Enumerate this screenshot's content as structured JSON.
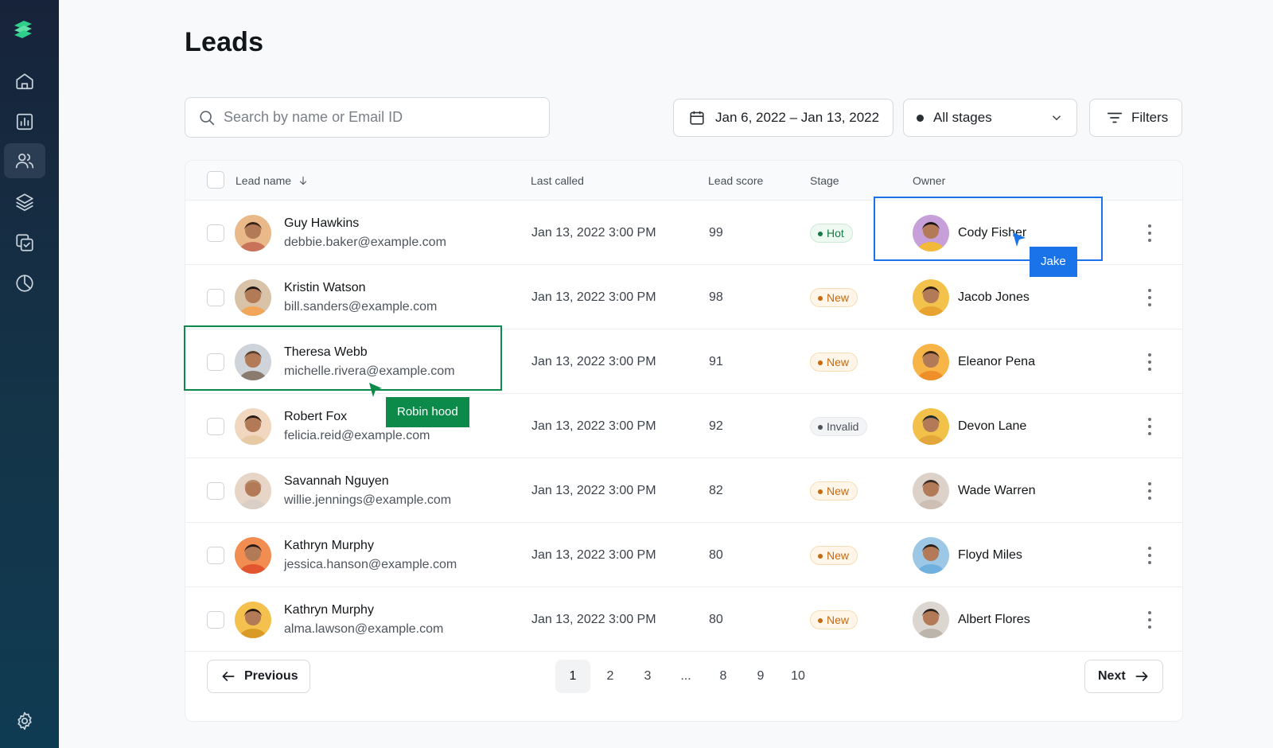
{
  "app": {
    "page_title": "Leads",
    "accent": "#0b8a4a",
    "brand_color": "#2fd08c"
  },
  "sidebar": {
    "items": [
      {
        "icon": "home-icon",
        "active": false
      },
      {
        "icon": "chart-bar-icon",
        "active": false
      },
      {
        "icon": "users-icon",
        "active": true
      },
      {
        "icon": "layers-icon",
        "active": false
      },
      {
        "icon": "copy-check-icon",
        "active": false
      },
      {
        "icon": "pie-chart-icon",
        "active": false
      }
    ],
    "settings_icon": "gear-icon"
  },
  "toolbar": {
    "search_placeholder": "Search by name or Email ID",
    "date_range": "Jan 6, 2022 – Jan 13, 2022",
    "stage_filter": "All stages",
    "filters_label": "Filters"
  },
  "table": {
    "headers": {
      "lead_name": "Lead name",
      "last_called": "Last called",
      "lead_score": "Lead score",
      "stage": "Stage",
      "owner": "Owner"
    },
    "rows": [
      {
        "name": "Guy Hawkins",
        "email": "debbie.baker@example.com",
        "last_called": "Jan 13, 2022 3:00 PM",
        "score": "99",
        "stage": "Hot",
        "owner": "Cody Fisher"
      },
      {
        "name": "Kristin Watson",
        "email": "bill.sanders@example.com",
        "last_called": "Jan 13, 2022 3:00 PM",
        "score": "98",
        "stage": "New",
        "owner": "Jacob Jones"
      },
      {
        "name": "Theresa Webb",
        "email": "michelle.rivera@example.com",
        "last_called": "Jan 13, 2022 3:00 PM",
        "score": "91",
        "stage": "New",
        "owner": "Eleanor Pena"
      },
      {
        "name": "Robert Fox",
        "email": "felicia.reid@example.com",
        "last_called": "Jan 13, 2022 3:00 PM",
        "score": "92",
        "stage": "Invalid",
        "owner": "Devon Lane"
      },
      {
        "name": "Savannah Nguyen",
        "email": "willie.jennings@example.com",
        "last_called": "Jan 13, 2022 3:00 PM",
        "score": "82",
        "stage": "New",
        "owner": "Wade Warren"
      },
      {
        "name": "Kathryn Murphy",
        "email": "jessica.hanson@example.com",
        "last_called": "Jan 13, 2022 3:00 PM",
        "score": "80",
        "stage": "New",
        "owner": "Floyd Miles"
      },
      {
        "name": "Kathryn Murphy",
        "email": "alma.lawson@example.com",
        "last_called": "Jan 13, 2022 3:00 PM",
        "score": "80",
        "stage": "New",
        "owner": "Albert Flores"
      }
    ]
  },
  "collaborators": {
    "jake": {
      "label": "Jake",
      "color": "#1a73e8"
    },
    "robin": {
      "label": "Robin hood",
      "color": "#0b8a4a"
    }
  },
  "pagination": {
    "previous_label": "Previous",
    "next_label": "Next",
    "pages": [
      "1",
      "2",
      "3",
      "...",
      "8",
      "9",
      "10"
    ],
    "current_page": "1"
  }
}
